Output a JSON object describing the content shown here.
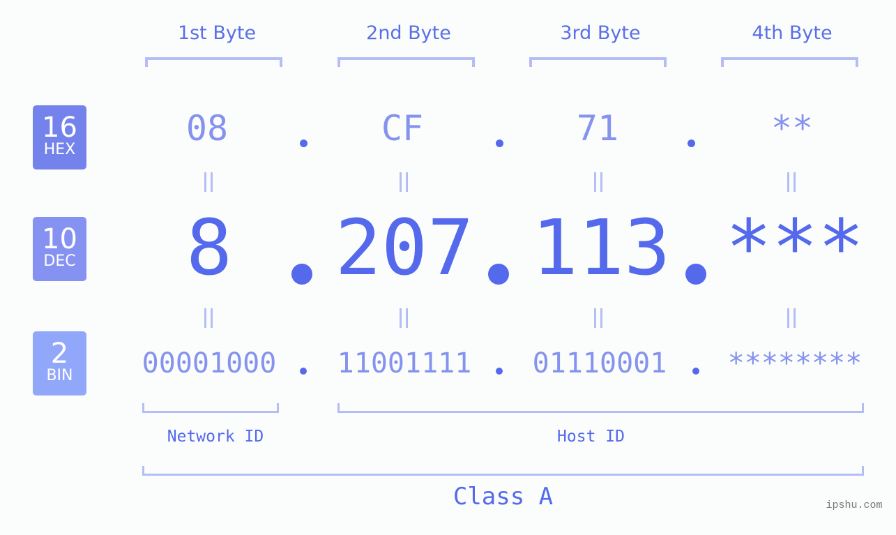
{
  "bytes": {
    "labels": [
      "1st Byte",
      "2nd Byte",
      "3rd Byte",
      "4th Byte"
    ]
  },
  "bases": [
    {
      "num": "16",
      "label": "HEX",
      "color": "#7483ec"
    },
    {
      "num": "10",
      "label": "DEC",
      "color": "#8592f2"
    },
    {
      "num": "2",
      "label": "BIN",
      "color": "#91a8fa"
    }
  ],
  "hex": [
    "08",
    "CF",
    "71",
    "**"
  ],
  "dec": [
    "8",
    "207",
    "113",
    "***"
  ],
  "bin": [
    "00001000",
    "11001111",
    "01110001",
    "********"
  ],
  "separator": ".",
  "equals": "=",
  "ids": {
    "network": "Network ID",
    "host": "Host ID"
  },
  "class_label": "Class A",
  "watermark": "ipshu.com",
  "colors": {
    "primary": "#5469ec",
    "light": "#8592ee",
    "bracket": "#b4bdf6"
  }
}
